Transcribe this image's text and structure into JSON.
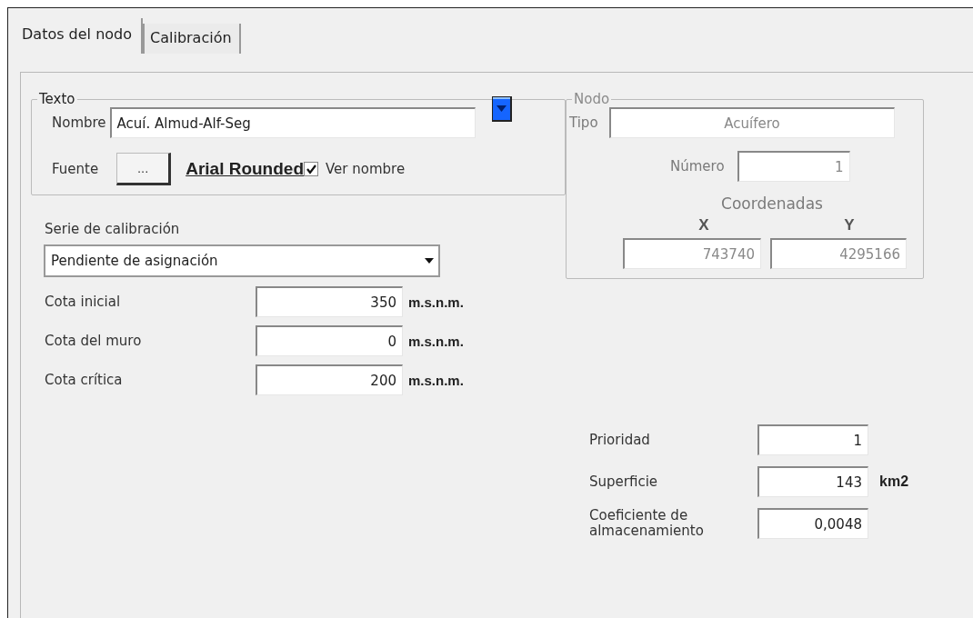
{
  "tabs": [
    {
      "label": "Datos del nodo",
      "selected": true
    },
    {
      "label": "Calibración",
      "selected": false
    }
  ],
  "texto_group": {
    "title": "Texto",
    "nombre_label": "Nombre",
    "nombre_value": "Acuí. Almud-Alf-Seg",
    "fuente_label": "Fuente",
    "fuente_button": "...",
    "font_name": "Arial Rounded",
    "ver_nombre": {
      "label": "Ver nombre",
      "checked": true
    }
  },
  "nodo_group": {
    "title": "Nodo",
    "disabled": true,
    "tipo_label": "Tipo",
    "tipo_value": "Acuífero",
    "numero_label": "Número",
    "numero_value": "1",
    "coordenadas_label": "Coordenadas",
    "x_label": "X",
    "y_label": "Y",
    "x_value": "743740",
    "y_value": "4295166"
  },
  "serie": {
    "label": "Serie de calibración",
    "value": "Pendiente de asignación"
  },
  "cotas": [
    {
      "label": "Cota inicial",
      "value": "350",
      "unit": "m.s.n.m."
    },
    {
      "label": "Cota del muro",
      "value": "0",
      "unit": "m.s.n.m."
    },
    {
      "label": "Cota crítica",
      "value": "200",
      "unit": "m.s.n.m."
    }
  ],
  "parametros": [
    {
      "label": "Prioridad",
      "value": "1"
    },
    {
      "label": "Superficie",
      "value": "143",
      "unit": "km2"
    },
    {
      "label": "Coeficiente de almacenamiento",
      "value": "0,0048"
    }
  ]
}
